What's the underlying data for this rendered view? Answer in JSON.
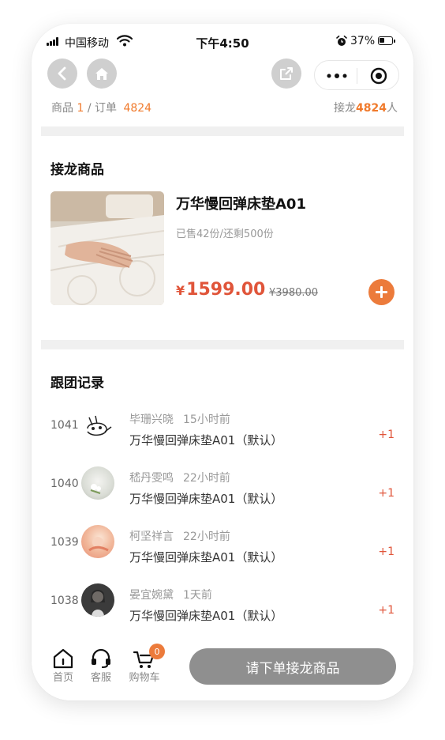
{
  "status_bar": {
    "carrier": "中国移动",
    "time": "下午4:50",
    "battery": "37%"
  },
  "nav": {
    "back_icon": "chevron-left-icon",
    "home_icon": "home-icon",
    "share_icon": "share-icon",
    "more_icon": "more-dots-icon",
    "target_icon": "target-icon"
  },
  "summary": {
    "goods_label": "商品",
    "goods_count": "1",
    "separator": "/",
    "order_label": "订单",
    "order_count": "4824",
    "jielong_prefix": "接龙",
    "jielong_count": "4824",
    "jielong_suffix": "人"
  },
  "product_section": {
    "title": "接龙商品",
    "product": {
      "name": "万华慢回弹床垫A01",
      "sold_info": "已售42份/还剩500份",
      "currency": "¥",
      "price": "1599.00",
      "original_price": "¥3980.00"
    }
  },
  "records_section": {
    "title": "跟团记录",
    "records": [
      {
        "number": "1041",
        "user": "毕珊兴晓",
        "time": "15小时前",
        "product": "万华慢回弹床垫A01（默认）",
        "count": "+1"
      },
      {
        "number": "1040",
        "user": "嵇丹雯鸣",
        "time": "22小时前",
        "product": "万华慢回弹床垫A01（默认）",
        "count": "+1"
      },
      {
        "number": "1039",
        "user": "柯坚祥言",
        "time": "22小时前",
        "product": "万华慢回弹床垫A01（默认）",
        "count": "+1"
      },
      {
        "number": "1038",
        "user": "晏宜婉黛",
        "time": "1天前",
        "product": "万华慢回弹床垫A01（默认）",
        "count": "+1"
      }
    ]
  },
  "tab_bar": {
    "home": "首页",
    "service": "客服",
    "cart": "购物车",
    "cart_badge": "0",
    "cta": "请下单接龙商品"
  },
  "colors": {
    "accent": "#f07a2c",
    "price": "#e0553a",
    "cta": "#8f8f8f"
  }
}
